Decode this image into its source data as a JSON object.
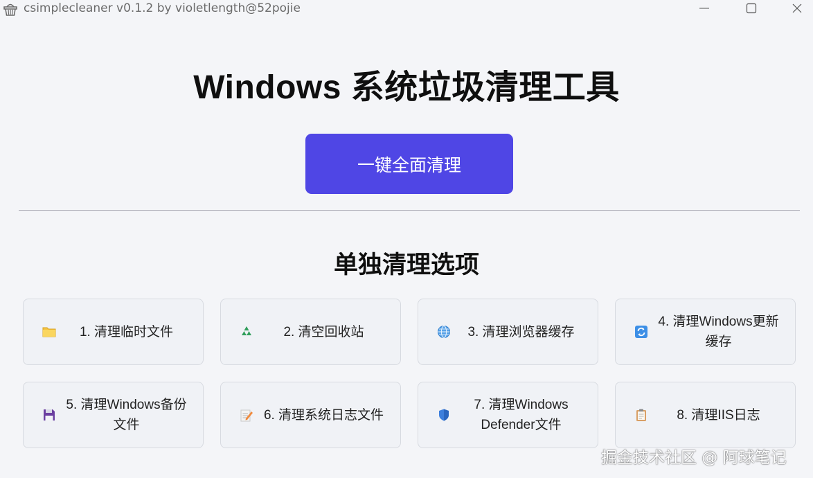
{
  "window": {
    "title": "csimplecleaner v0.1.2 by violetlength@52pojie",
    "app_icon": "trash-basket-icon",
    "controls": [
      "minimize-icon",
      "maximize-icon",
      "close-icon"
    ]
  },
  "header": {
    "title": "Windows 系统垃圾清理工具"
  },
  "actions": {
    "clean_all_label": "一键全面清理",
    "accent_color": "#4f46e5"
  },
  "section": {
    "title": "单独清理选项"
  },
  "options": [
    {
      "label": "1. 清理临时文件",
      "icon": "folder-icon"
    },
    {
      "label": "2. 清空回收站",
      "icon": "recycle-icon"
    },
    {
      "label": "3. 清理浏览器缓存",
      "icon": "globe-icon"
    },
    {
      "label": "4. 清理Windows更新缓存",
      "icon": "refresh-icon"
    },
    {
      "label": "5. 清理Windows备份文件",
      "icon": "floppy-disk-icon"
    },
    {
      "label": "6. 清理系统日志文件",
      "icon": "memo-icon"
    },
    {
      "label": "7. 清理Windows Defender文件",
      "icon": "shield-icon"
    },
    {
      "label": "8. 清理IIS日志",
      "icon": "clipboard-icon"
    }
  ],
  "watermark": "掘金技术社区 @ 阿球笔记"
}
